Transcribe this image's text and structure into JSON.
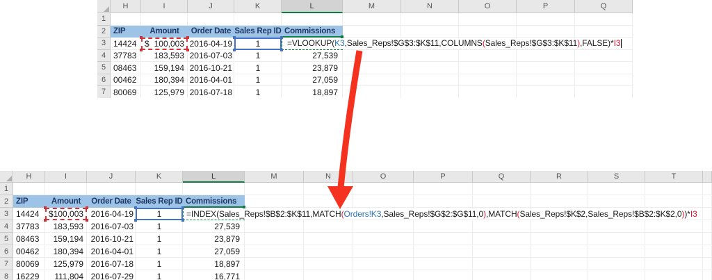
{
  "colors": {
    "header_fill": "#9DC3E6",
    "header_text": "#1F3864",
    "formula_black": "#1A1A1A",
    "formula_blue": "#2E75B6",
    "formula_red": "#E8112D",
    "box_blue": "#4472C4",
    "box_red": "#D13438",
    "active_green": "#107C41",
    "arrow_red": "#F5321F"
  },
  "top_sheet": {
    "column_letters": [
      "H",
      "I",
      "J",
      "K",
      "L",
      "M",
      "N",
      "O",
      "P",
      "Q"
    ],
    "selected_column": "L",
    "row_numbers": [
      "1",
      "2",
      "3",
      "4",
      "5",
      "6",
      "7"
    ],
    "column_headers": [
      "ZIP",
      "Amount",
      "Order Date",
      "Sales Rep ID",
      "Commissions"
    ],
    "data_rows": [
      [
        "14424",
        "$ 100,003",
        "2016-04-19",
        "1",
        ""
      ],
      [
        "37783",
        "183,593",
        "2016-07-03",
        "1",
        "27,539"
      ],
      [
        "08463",
        "159,194",
        "2016-10-21",
        "1",
        "23,879"
      ],
      [
        "00462",
        "180,394",
        "2016-04-01",
        "1",
        "27,059"
      ],
      [
        "80069",
        "125,979",
        "2016-07-18",
        "1",
        "18,897"
      ]
    ],
    "formula_segments": [
      {
        "text": "=VLOOKUP(",
        "color": "formula_black"
      },
      {
        "text": "K3",
        "color": "formula_blue"
      },
      {
        "text": ",Sales_Reps!$G$3:$K$11,COLUMNS",
        "color": "formula_black"
      },
      {
        "text": "(",
        "color": "formula_red"
      },
      {
        "text": "Sales_Reps!$G$3:$K$11",
        "color": "formula_black"
      },
      {
        "text": ")",
        "color": "formula_red"
      },
      {
        "text": ",FALSE)*",
        "color": "formula_black"
      },
      {
        "text": "I3",
        "color": "formula_red"
      }
    ],
    "has_cursor": true
  },
  "bottom_sheet": {
    "column_letters": [
      "H",
      "I",
      "J",
      "K",
      "L",
      "M",
      "N",
      "O",
      "P",
      "Q",
      "R",
      "S",
      "T",
      ""
    ],
    "selected_column": "L",
    "row_numbers": [
      "1",
      "2",
      "3",
      "4",
      "5",
      "6",
      "7",
      "8"
    ],
    "column_headers": [
      "ZIP",
      "Amount",
      "Order Date",
      "Sales Rep ID",
      "Commissions"
    ],
    "data_rows": [
      [
        "14424",
        "$ 100,003",
        "2016-04-19",
        "1",
        ""
      ],
      [
        "37783",
        "183,593",
        "2016-07-03",
        "1",
        "27,539"
      ],
      [
        "08463",
        "159,194",
        "2016-10-21",
        "1",
        "23,879"
      ],
      [
        "00462",
        "180,394",
        "2016-04-01",
        "1",
        "27,059"
      ],
      [
        "80069",
        "125,979",
        "2016-07-18",
        "1",
        "18,897"
      ],
      [
        "16229",
        "111,804",
        "2016-07-29",
        "1",
        "16,771"
      ]
    ],
    "formula_segments": [
      {
        "text": "=INDEX(Sales_Reps!$B$2:$K$11,MATCH",
        "color": "formula_black"
      },
      {
        "text": "(",
        "color": "formula_red"
      },
      {
        "text": "Orders!K3",
        "color": "formula_blue"
      },
      {
        "text": ",Sales_Reps!$G$2:$G$11,0",
        "color": "formula_black"
      },
      {
        "text": ")",
        "color": "formula_red"
      },
      {
        "text": ",MATCH",
        "color": "formula_black"
      },
      {
        "text": "(",
        "color": "formula_red"
      },
      {
        "text": "Sales_Reps!$K$2,Sales_Reps!$B$2:$K$2,0",
        "color": "formula_black"
      },
      {
        "text": ")",
        "color": "formula_red"
      },
      {
        "text": ")*",
        "color": "formula_black"
      },
      {
        "text": "I3",
        "color": "formula_red"
      }
    ],
    "has_cursor": false
  }
}
